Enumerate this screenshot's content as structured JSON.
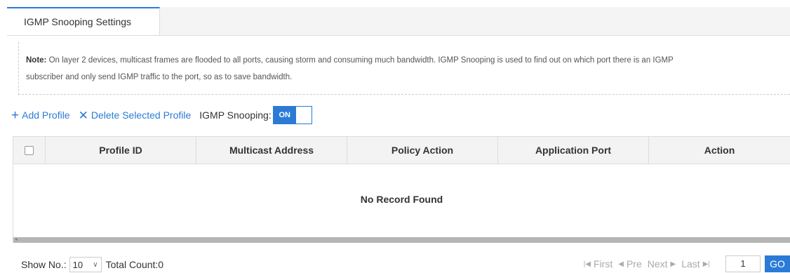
{
  "tabs": [
    {
      "label": "IGMP Snooping Settings",
      "active": true
    }
  ],
  "note": {
    "prefix": "Note:",
    "line1": " On layer 2 devices, multicast frames are flooded to all ports, causing storm and consuming much bandwidth. IGMP Snooping is used to find out on which port there is an IGMP",
    "line2": "subscriber and only send IGMP traffic to the port, so as to save bandwidth."
  },
  "toolbar": {
    "add_label": "Add Profile",
    "add_icon": "plus-icon",
    "delete_label": "Delete Selected Profile",
    "delete_icon": "x-icon",
    "snooping_label": "IGMP Snooping:",
    "toggle_label": "ON",
    "toggle_state": "on"
  },
  "table": {
    "columns": [
      "Profile ID",
      "Multicast Address",
      "Policy Action",
      "Application Port",
      "Action"
    ],
    "rows": [],
    "empty_text": "No Record Found"
  },
  "footer": {
    "show_label": "Show No.:",
    "page_size": "10",
    "total_label": "Total Count:0",
    "first": "First",
    "prev": "Pre",
    "next": "Next",
    "last": "Last",
    "page": "1",
    "go": "GO"
  },
  "colors": {
    "accent": "#2b7bd6",
    "header_bg": "#f3f3f3",
    "disabled_text": "#aaaaaa"
  }
}
